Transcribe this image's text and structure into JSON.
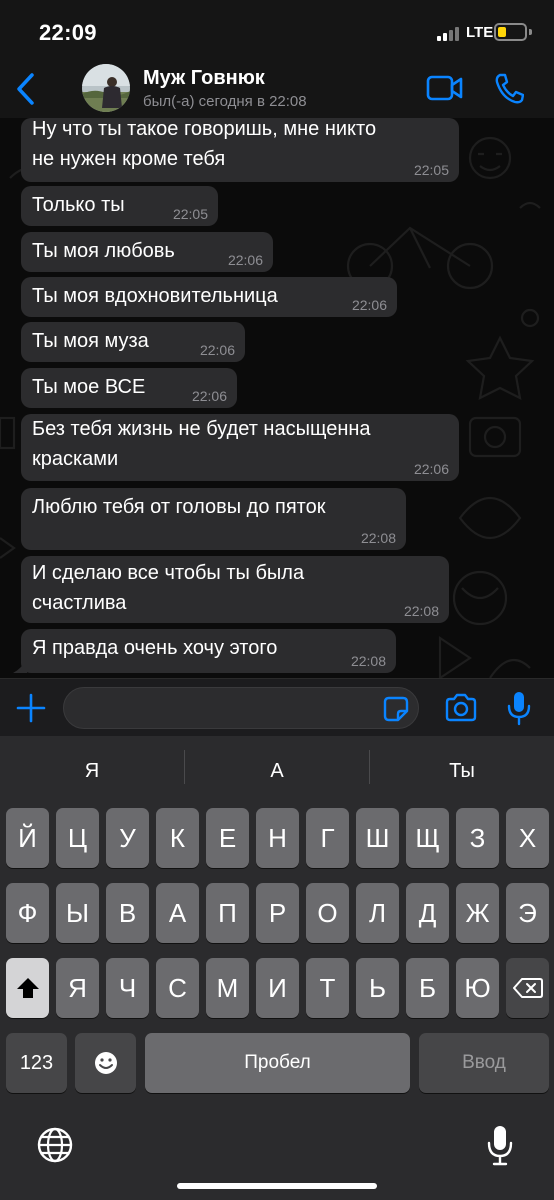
{
  "status_bar": {
    "time": "22:09",
    "network": "LTE",
    "battery_level": 0.25
  },
  "header": {
    "contact_name": "Муж Говнюк",
    "contact_status": "был(-а) сегодня в 22:08",
    "back_icon": "chevron-left-icon",
    "video_icon": "video-camera-icon",
    "call_icon": "phone-icon"
  },
  "messages": [
    {
      "text": "Ну что ты такое говоришь, мне никто\nне нужен кроме тебя",
      "time": "22:05"
    },
    {
      "text": "Только ты",
      "time": "22:05"
    },
    {
      "text": "Ты моя любовь",
      "time": "22:06"
    },
    {
      "text": "Ты моя вдохновительница",
      "time": "22:06"
    },
    {
      "text": "Ты моя муза",
      "time": "22:06"
    },
    {
      "text": "Ты мое ВСЕ",
      "time": "22:06"
    },
    {
      "text": "Без тебя жизнь не будет насыщенна\nкрасками",
      "time": "22:06"
    },
    {
      "text": "Люблю тебя от головы до пяток",
      "time": "22:08"
    },
    {
      "text": "И сделаю все чтобы ты была\nсчастлива",
      "time": "22:08"
    },
    {
      "text": "Я правда очень хочу этого",
      "time": "22:08"
    }
  ],
  "composer": {
    "input_value": "",
    "placeholder": ""
  },
  "keyboard": {
    "suggestions": [
      "Я",
      "А",
      "Ты"
    ],
    "row1": [
      "Й",
      "Ц",
      "У",
      "К",
      "Е",
      "Н",
      "Г",
      "Ш",
      "Щ",
      "З",
      "Х"
    ],
    "row2": [
      "Ф",
      "Ы",
      "В",
      "А",
      "П",
      "Р",
      "О",
      "Л",
      "Д",
      "Ж",
      "Э"
    ],
    "row3": [
      "Я",
      "Ч",
      "С",
      "М",
      "И",
      "Т",
      "Ь",
      "Б",
      "Ю"
    ],
    "numbers_label": "123",
    "space_label": "Пробел",
    "enter_label": "Ввод"
  },
  "colors": {
    "accent": "#0a84ff",
    "bubble": "#2c2c2e",
    "battery": "#ffd60a"
  }
}
